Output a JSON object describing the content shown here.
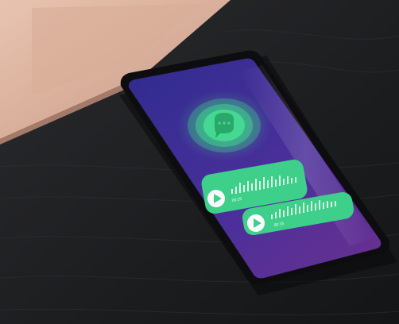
{
  "scene": {
    "description_colors": {
      "table": "#1e1f21",
      "laptop": "#d9b09c",
      "phone_screen_top": "#3a2a9a",
      "phone_screen_bottom": "#5a2f8c",
      "accent_green": "#3ecf8a"
    }
  },
  "voice_messages": [
    {
      "duration": "00:15"
    },
    {
      "duration": "00:15"
    }
  ],
  "icons": {
    "chat": "chat-bubble-icon",
    "play": "play-icon"
  }
}
